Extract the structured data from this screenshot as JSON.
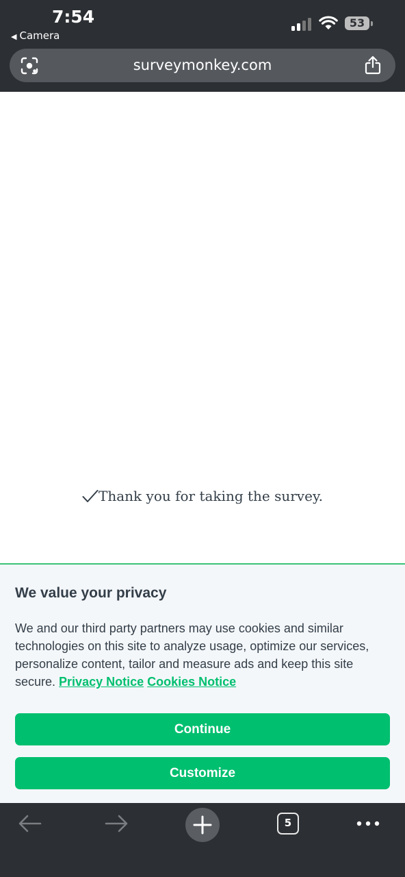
{
  "status_bar": {
    "time": "7:54",
    "back_app": "Camera",
    "battery": "53"
  },
  "browser": {
    "url": "surveymonkey.com",
    "tab_count": "5"
  },
  "page": {
    "thank_you": "Thank you for taking the survey."
  },
  "privacy_banner": {
    "title": "We value your privacy",
    "body": "We and our third party partners may use cookies and similar technologies on this site to analyze usage, optimize our services, personalize content, tailor and measure ads and keep this site secure.",
    "privacy_link": "Privacy Notice",
    "cookies_link": "Cookies Notice",
    "continue_label": "Continue",
    "customize_label": "Customize"
  },
  "colors": {
    "accent": "#00bf6f",
    "chrome_bg": "#2c2f33",
    "text": "#333e48"
  },
  "icons": [
    "lens-icon",
    "share-icon",
    "check-icon",
    "back-arrow-icon",
    "forward-arrow-icon",
    "plus-icon",
    "more-icon"
  ]
}
